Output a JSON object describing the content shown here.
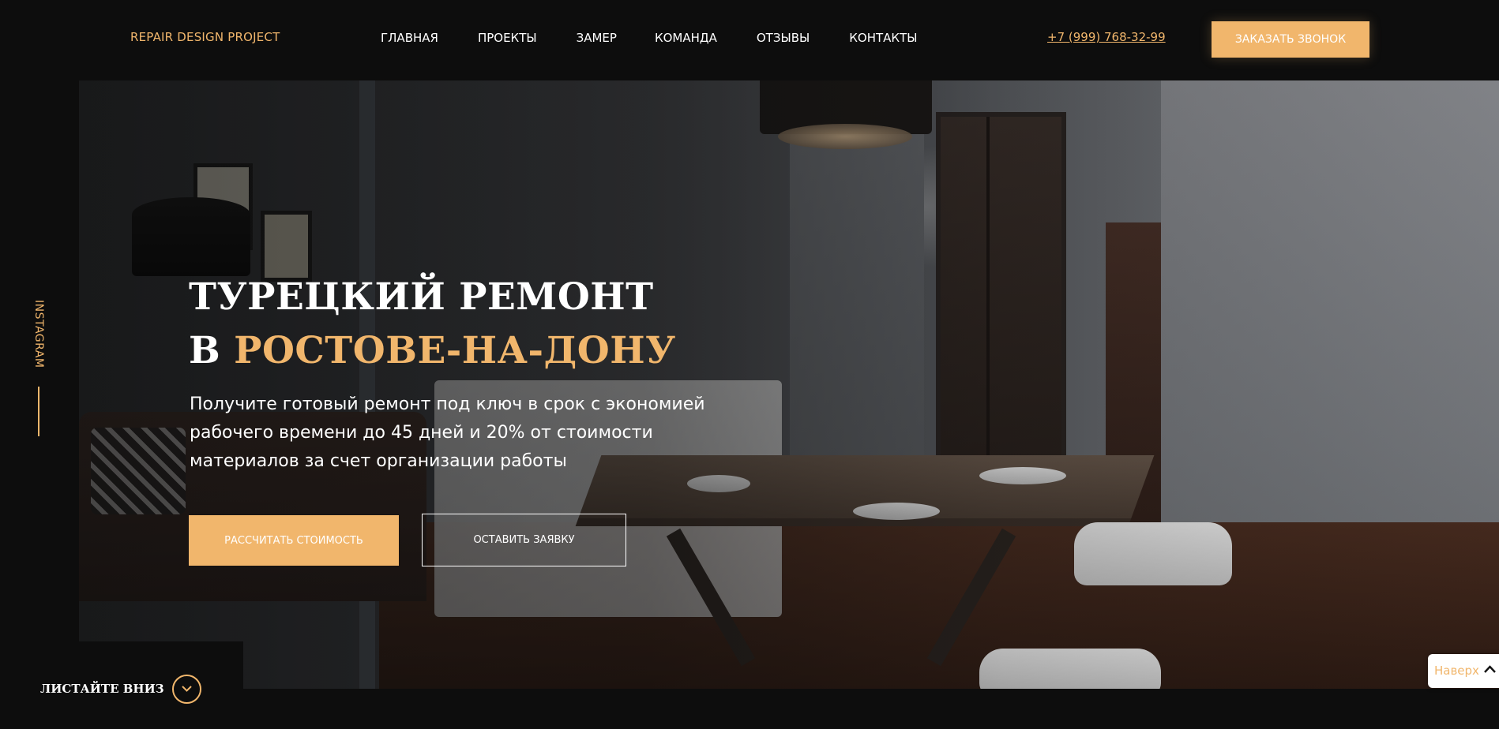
{
  "colors": {
    "accent": "#f1b66c",
    "background": "#0d0d0d",
    "text": "#ffffff"
  },
  "header": {
    "logo": "REPAIR DESIGN PROJECT",
    "nav": [
      "ГЛАВНАЯ",
      "ПРОЕКТЫ",
      "ЗАМЕР",
      "КОМАНДА",
      "ОТЗЫВЫ",
      "КОНТАКТЫ"
    ],
    "phone": "+7 (999) 768-32-99",
    "cta_label": "ЗАКАЗАТЬ ЗВОНОК"
  },
  "hero": {
    "title_line1": "ТУРЕЦКИЙ РЕМОНТ",
    "title_prefix": "В",
    "title_accent": "РОСТОВЕ-НА-ДОНУ",
    "subtitle": "Получите готовый ремонт под ключ в срок с экономией рабочего времени до 45 дней и 20% от стоимости материалов за счет организации работы",
    "primary_button": "РАССЧИТАТЬ СТОИМОСТЬ",
    "secondary_button": "ОСТАВИТЬ ЗАЯВКУ"
  },
  "side": {
    "instagram_label": "INSTAGRAM"
  },
  "scroll": {
    "label": "ЛИСТАЙТЕ ВНИЗ",
    "icon": "chevron-down-icon"
  },
  "back_to_top": {
    "label": "Наверх",
    "icon": "chevron-up-icon"
  }
}
